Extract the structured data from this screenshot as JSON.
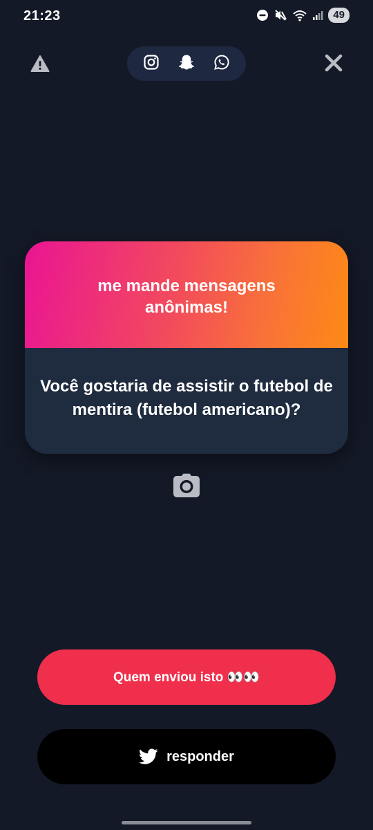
{
  "status_bar": {
    "time": "21:23",
    "battery": "49",
    "icons": [
      "do-not-disturb-icon",
      "mute-icon",
      "wifi-icon",
      "signal-icon"
    ]
  },
  "top_bar": {
    "warning_icon": "warning-icon",
    "share_icons": [
      "instagram-icon",
      "snapchat-icon",
      "whatsapp-icon"
    ],
    "close_icon": "close-icon"
  },
  "card": {
    "title": "me mande mensagens anônimas!",
    "question": "Você gostaria de assistir o futebol de mentira (futebol americano)?",
    "gradient_start": "#ea1593",
    "gradient_end": "#fd8a15",
    "body_color": "#1f2b3e"
  },
  "camera_icon": "camera-icon",
  "buttons": {
    "who_sent": "Quem enviou isto 👀👀",
    "reply": "responder",
    "reply_icon": "twitter-icon"
  },
  "colors": {
    "background": "#141927",
    "accent_red": "#ef2f4b",
    "pill": "#1e2840"
  }
}
